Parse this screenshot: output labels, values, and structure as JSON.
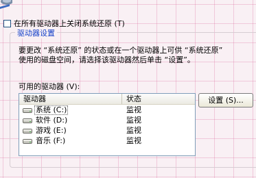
{
  "checkbox": {
    "label": "在所有驱动器上关闭系统还原 (T)",
    "checked": false
  },
  "group": {
    "title": "驱动器设置",
    "description_line1": "要更改 “系统还原” 的状态或在一个驱动器上可供 “系统还原”",
    "description_line2": "使用的磁盘空间，请选择该驱动器然后单击 “设置”。"
  },
  "available_label": "可用的驱动器 (V):",
  "columns": {
    "drive": "驱动器",
    "status": "状态"
  },
  "drives": [
    {
      "name": "系统 (C:)",
      "status": "监视",
      "icon": "hard-drive-icon"
    },
    {
      "name": "软件 (D:)",
      "status": "监视",
      "icon": "hard-drive-icon"
    },
    {
      "name": "游戏 (E:)",
      "status": "监视",
      "icon": "hard-drive-icon"
    },
    {
      "name": "音乐 (F:)",
      "status": "监视",
      "icon": "hard-drive-icon"
    }
  ],
  "settings_button": "设置 (S)...",
  "colors": {
    "group_title": "#1440c8",
    "background": "#f9f0f4",
    "grid_lines": "#d75f96",
    "list_border": "#7f9db9"
  }
}
